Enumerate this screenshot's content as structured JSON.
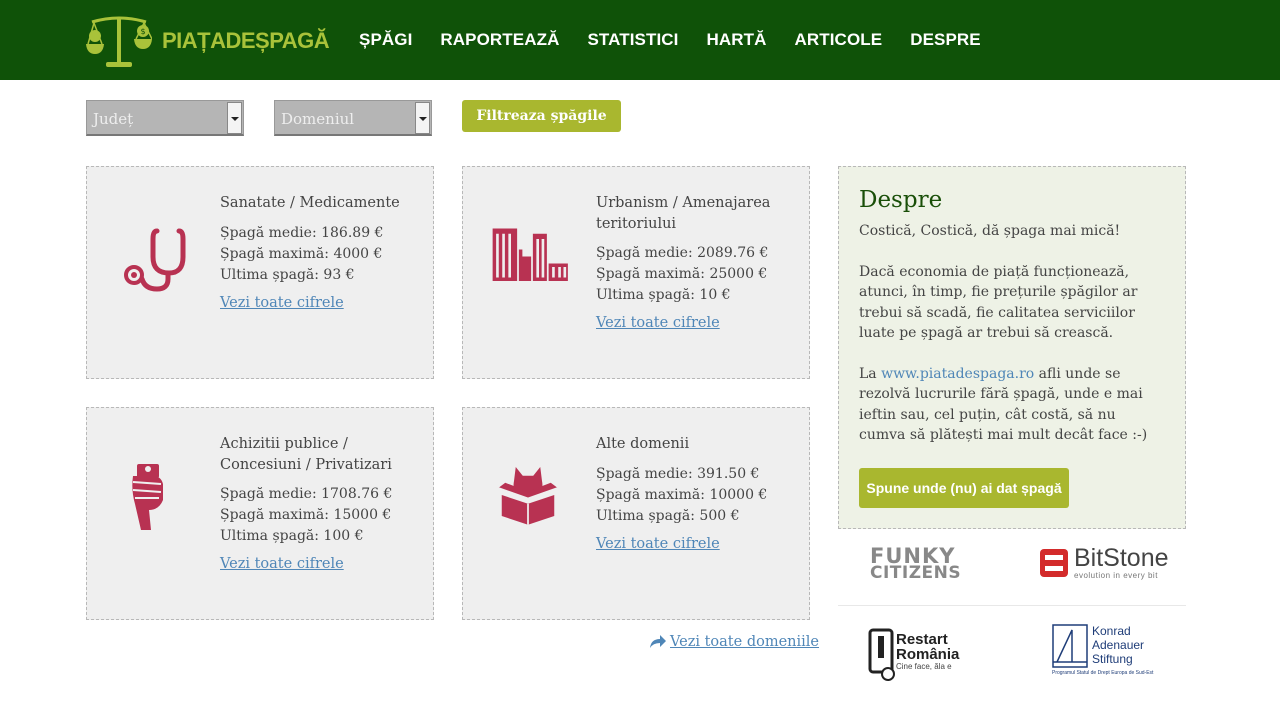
{
  "brand": {
    "logo_text": "PIAȚADEȘPAGĂ",
    "green": "#0f5208",
    "lime": "#a9c23a",
    "accent_red": "#b83252"
  },
  "nav": [
    "ȘPĂGI",
    "RAPORTEAZĂ",
    "STATISTICI",
    "HARTĂ",
    "ARTICOLE",
    "DESPRE"
  ],
  "filters": {
    "judet": "Județ",
    "domeniul": "Domeniul",
    "button": "Filtreaza șpăgile"
  },
  "cards": [
    {
      "title": "Sanatate / Medicamente",
      "medie": "Șpagă medie: 186.89 €",
      "maxima": "Șpagă maximă: 4000 €",
      "ultima": "Ultima șpagă: 93 €",
      "link": "Vezi toate cifrele",
      "icon": "stethoscope-icon"
    },
    {
      "title": "Urbanism / Amenajarea teritoriului",
      "medie": "Șpagă medie: 2089.76 €",
      "maxima": "Șpagă maximă: 25000 €",
      "ultima": "Ultima șpagă: 10 €",
      "link": "Vezi toate cifrele",
      "icon": "buildings-icon"
    },
    {
      "title": "Achizitii publice / Concesiuni / Privatizari",
      "medie": "Șpagă medie: 1708.76 €",
      "maxima": "Șpagă maximă: 15000 €",
      "ultima": "Ultima șpagă: 100 €",
      "link": "Vezi toate cifrele",
      "icon": "hand-money-icon"
    },
    {
      "title": "Alte domenii",
      "medie": "Șpagă medie: 391.50 €",
      "maxima": "Șpagă maximă: 10000 €",
      "ultima": "Ultima șpagă: 500 €",
      "link": "Vezi toate cifrele",
      "icon": "cat-in-box-icon"
    }
  ],
  "all_domains": "Vezi toate domeniile",
  "despre": {
    "title": "Despre",
    "p1": "Costică, Costică, dă șpaga mai mică!",
    "p2": "Dacă economia de piață funcționează, atunci, în timp, fie prețurile șpăgilor ar trebui să scadă, fie calitatea serviciilor luate pe șpagă ar trebui să crească.",
    "p3_pre": "La ",
    "p3_url": "www.piatadespaga.ro",
    "p3_post": " afli unde se rezolvă lucrurile fără șpagă, unde e mai ieftin sau, cel puțin, cât costă, să nu cumva să plătești mai mult decât face :-)",
    "button": "Spune unde (nu) ai dat șpagă"
  },
  "sponsors": {
    "funky_1": "FUNKY",
    "funky_2": "CITIZENS",
    "bitstone": "BitStone",
    "bitstone_tag": "evolution in every bit",
    "restart_1": "Restart",
    "restart_2": "România",
    "restart_tag": "Cine face, ăla e",
    "konrad_1": "Konrad",
    "konrad_2": "Adenauer",
    "konrad_3": "Stiftung",
    "konrad_tag": "Programul Statul de Drept Europa de Sud-Est"
  }
}
